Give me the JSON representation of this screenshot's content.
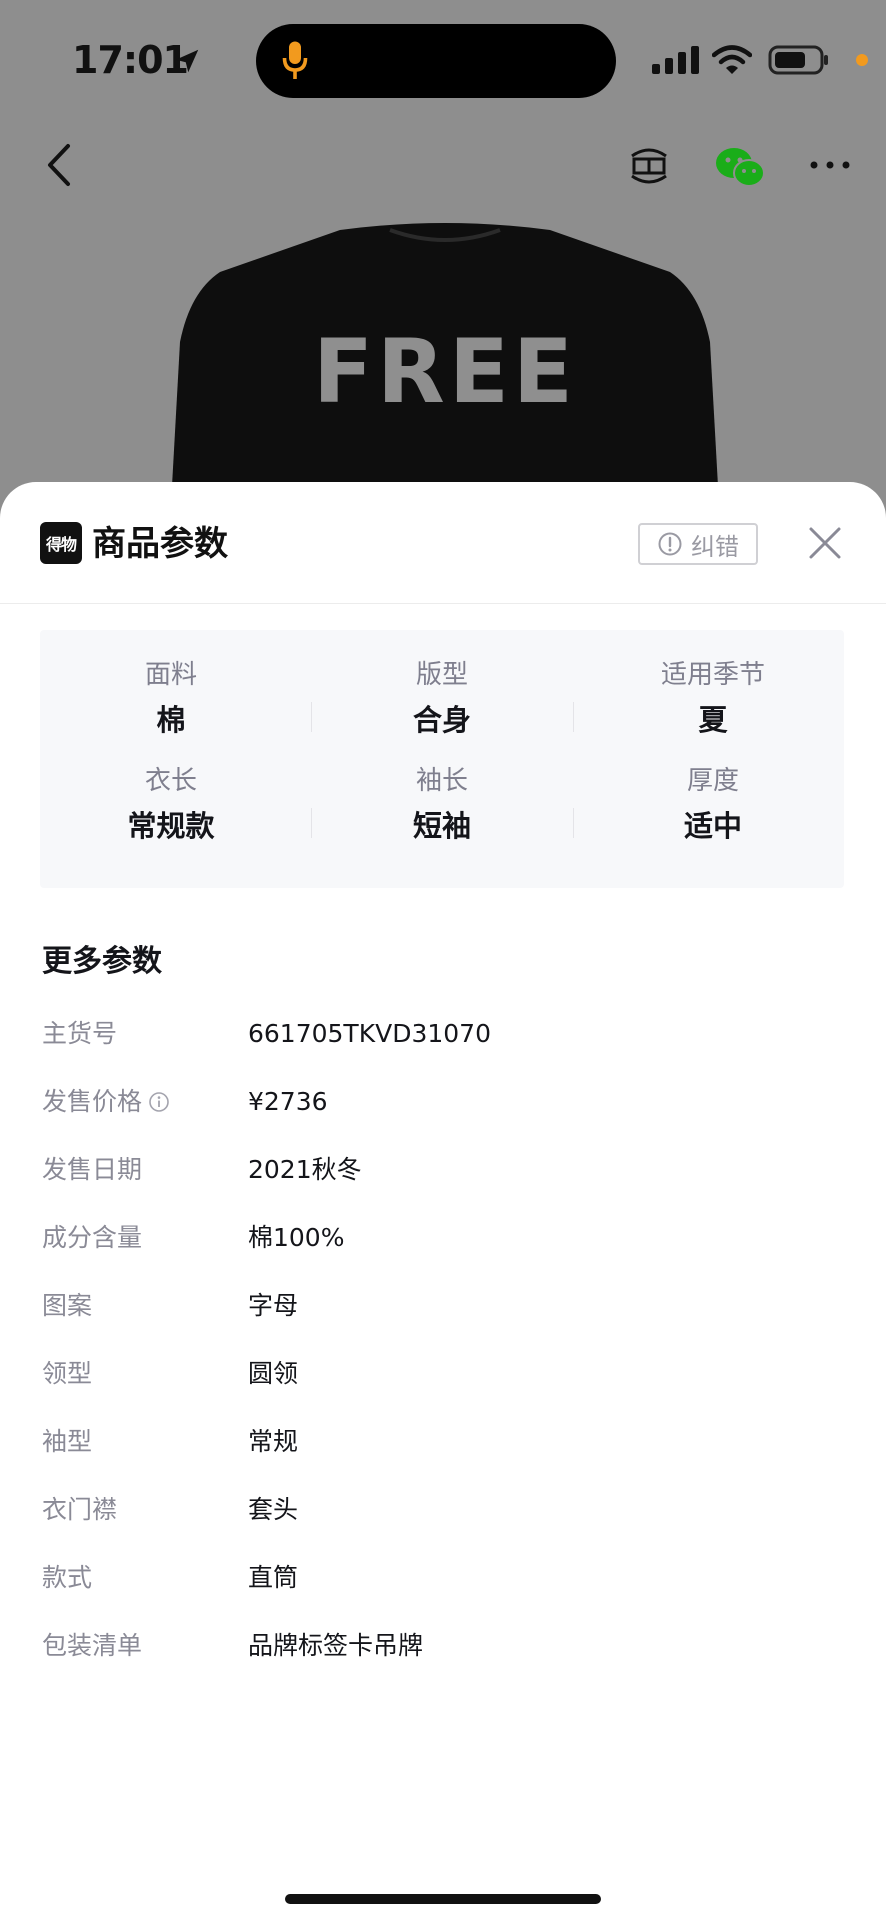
{
  "status_bar": {
    "time": "17:01"
  },
  "sheet": {
    "logo_text": "得物",
    "title": "商品参数",
    "report_label": "纠错",
    "params": [
      {
        "label": "面料",
        "value": "棉"
      },
      {
        "label": "版型",
        "value": "合身"
      },
      {
        "label": "适用季节",
        "value": "夏"
      },
      {
        "label": "衣长",
        "value": "常规款"
      },
      {
        "label": "袖长",
        "value": "短袖"
      },
      {
        "label": "厚度",
        "value": "适中"
      }
    ],
    "more_title": "更多参数",
    "specs": [
      {
        "key": "主货号",
        "value": "661705TKVD31070"
      },
      {
        "key": "发售价格",
        "value": "¥2736"
      },
      {
        "key": "发售日期",
        "value": "2021秋冬"
      },
      {
        "key": "成分含量",
        "value": "棉100%"
      },
      {
        "key": "图案",
        "value": "字母"
      },
      {
        "key": "领型",
        "value": "圆领"
      },
      {
        "key": "袖型",
        "value": "常规"
      },
      {
        "key": "衣门襟",
        "value": "套头"
      },
      {
        "key": "款式",
        "value": "直筒"
      },
      {
        "key": "包装清单",
        "value": "品牌标签卡吊牌"
      }
    ]
  },
  "product_image": {
    "print_text": "FREE"
  },
  "icons": {
    "back": "chevron-left-icon",
    "sell": "sell-icon",
    "share": "wechat-icon",
    "more": "more-icon",
    "close": "close-icon",
    "report": "alert-circle-icon",
    "info": "info-icon"
  },
  "colors": {
    "accent_orange": "#f29a1e",
    "wechat_green": "#1aad19",
    "sheet_bg": "#ffffff",
    "param_bg": "#f7f8fa"
  }
}
